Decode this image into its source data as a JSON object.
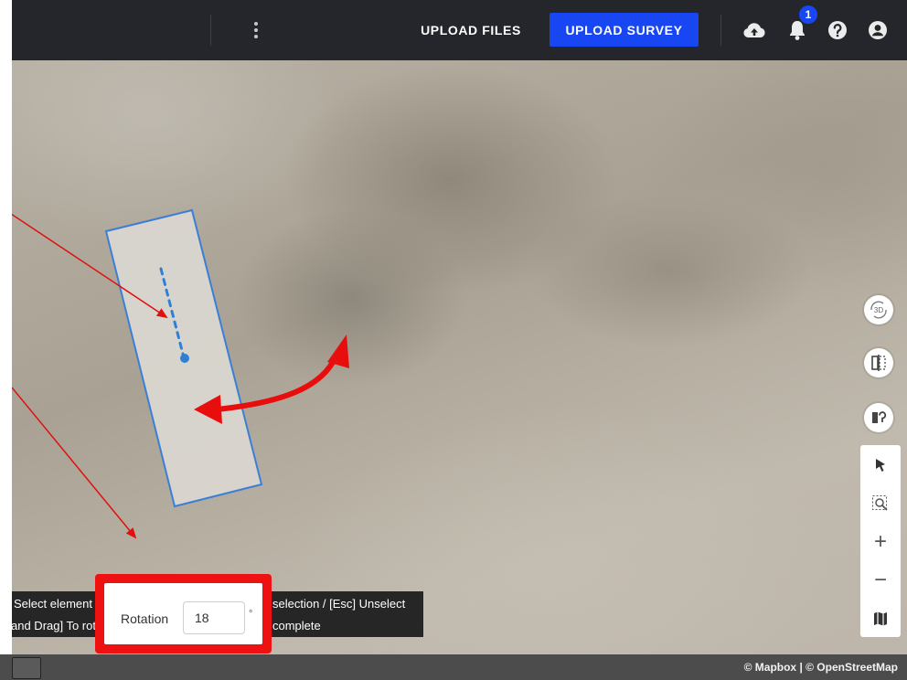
{
  "header": {
    "upload_files_label": "UPLOAD FILES",
    "upload_survey_label": "UPLOAD SURVEY",
    "notification_count": "1",
    "icons": [
      "more-vert-icon",
      "cloud-upload-icon",
      "bell-icon",
      "help-icon",
      "account-icon"
    ]
  },
  "map_controls": {
    "view_3d_label": "3D",
    "icons": [
      "3d-view-icon",
      "compare-split-icon",
      "geolocate-icon",
      "select-pointer-icon",
      "zoom-area-icon",
      "zoom-in-icon",
      "zoom-out-icon",
      "basemap-icon"
    ],
    "zoom_in": "+",
    "zoom_out": "−"
  },
  "hints": {
    "line1_a": "Select element",
    "line1_b": "selection / [Esc] Unselect",
    "line2_a": "and Drag] To rot",
    "line2_b": "complete"
  },
  "rotation": {
    "label": "Rotation",
    "value": "18",
    "unit": "°"
  },
  "attribution": "© Mapbox | © OpenStreetMap",
  "colors": {
    "topbar": "#24262b",
    "accent": "#1746f2",
    "annotation_red": "#ee1111",
    "shape_outline": "#3a7fd5"
  }
}
